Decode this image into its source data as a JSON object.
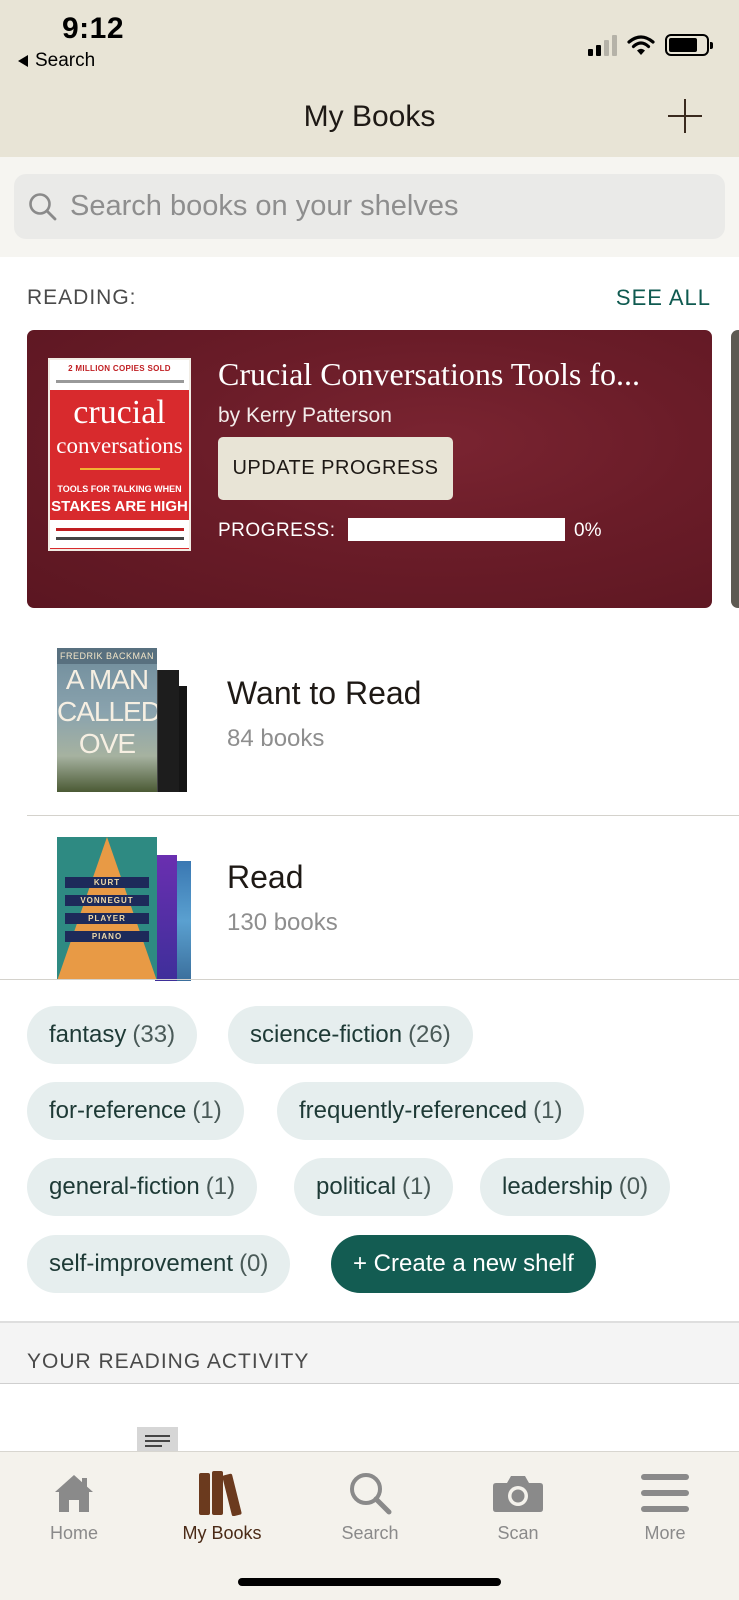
{
  "status_bar": {
    "time": "9:12",
    "back_label": "Search"
  },
  "header": {
    "title": "My Books"
  },
  "search": {
    "placeholder": "Search books on your shelves"
  },
  "reading": {
    "section_label": "READING:",
    "see_all_label": "SEE ALL",
    "book": {
      "title": "Crucial Conversations Tools fo...",
      "author": "by Kerry Patterson",
      "update_button": "UPDATE PROGRESS",
      "progress_label": "PROGRESS:",
      "progress_value": "0%",
      "progress_fraction": 0,
      "cover": {
        "banner": "2 MILLION COPIES SOLD",
        "title_line1": "crucial",
        "title_line2": "conversations",
        "subtitle_line1": "TOOLS FOR TALKING WHEN",
        "subtitle_line2": "STAKES ARE HIGH"
      }
    }
  },
  "shelves": [
    {
      "name": "Want to Read",
      "count": "84 books",
      "cover": {
        "author": "FREDRIK BACKMAN",
        "title": "A MAN CALLED OVE"
      }
    },
    {
      "name": "Read",
      "count": "130 books",
      "cover": {
        "line1": "KURT",
        "line2": "VONNEGUT",
        "line3": "PLAYER",
        "line4": "PIANO"
      }
    }
  ],
  "tags": [
    {
      "name": "fantasy",
      "count": "(33)"
    },
    {
      "name": "science-fiction",
      "count": "(26)"
    },
    {
      "name": "for-reference",
      "count": "(1)"
    },
    {
      "name": "frequently-referenced",
      "count": "(1)"
    },
    {
      "name": "general-fiction",
      "count": "(1)"
    },
    {
      "name": "political",
      "count": "(1)"
    },
    {
      "name": "leadership",
      "count": "(0)"
    },
    {
      "name": "self-improvement",
      "count": "(0)"
    }
  ],
  "create_shelf_label": "+ Create a new shelf",
  "activity": {
    "section_label": "YOUR READING ACTIVITY"
  },
  "tabbar": {
    "items": [
      {
        "label": "Home",
        "icon": "home-icon"
      },
      {
        "label": "My Books",
        "icon": "books-icon"
      },
      {
        "label": "Search",
        "icon": "search-icon"
      },
      {
        "label": "Scan",
        "icon": "camera-icon"
      },
      {
        "label": "More",
        "icon": "menu-icon"
      }
    ],
    "active": "My Books"
  },
  "colors": {
    "header_bg": "#e8e4d6",
    "accent_teal": "#135c52",
    "card_maroon": "#6a1c28",
    "active_tab": "#4a2a16",
    "inactive_tab": "#8a8a8a"
  }
}
